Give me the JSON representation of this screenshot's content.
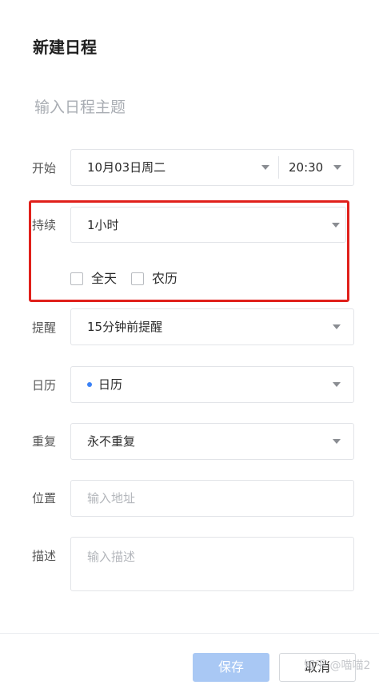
{
  "header": {
    "title": "新建日程"
  },
  "subject": {
    "placeholder": "输入日程主题"
  },
  "start": {
    "label": "开始",
    "date": "10月03日周二",
    "time": "20:30"
  },
  "duration": {
    "label": "持续",
    "value": "1小时",
    "all_day_label": "全天",
    "lunar_label": "农历",
    "all_day_checked": false,
    "lunar_checked": false
  },
  "reminder": {
    "label": "提醒",
    "value": "15分钟前提醒"
  },
  "calendar": {
    "label": "日历",
    "value": "日历",
    "dot_color": "#3b82f6"
  },
  "repeat": {
    "label": "重复",
    "value": "永不重复"
  },
  "location": {
    "label": "位置",
    "placeholder": "输入地址"
  },
  "description": {
    "label": "描述",
    "placeholder": "输入描述"
  },
  "footer": {
    "save_label": "保存",
    "cancel_label": "取消"
  },
  "watermark": "知乎 @喵喵2",
  "colors": {
    "highlight": "#e0201b",
    "primary_disabled": "#a9c8f4"
  }
}
